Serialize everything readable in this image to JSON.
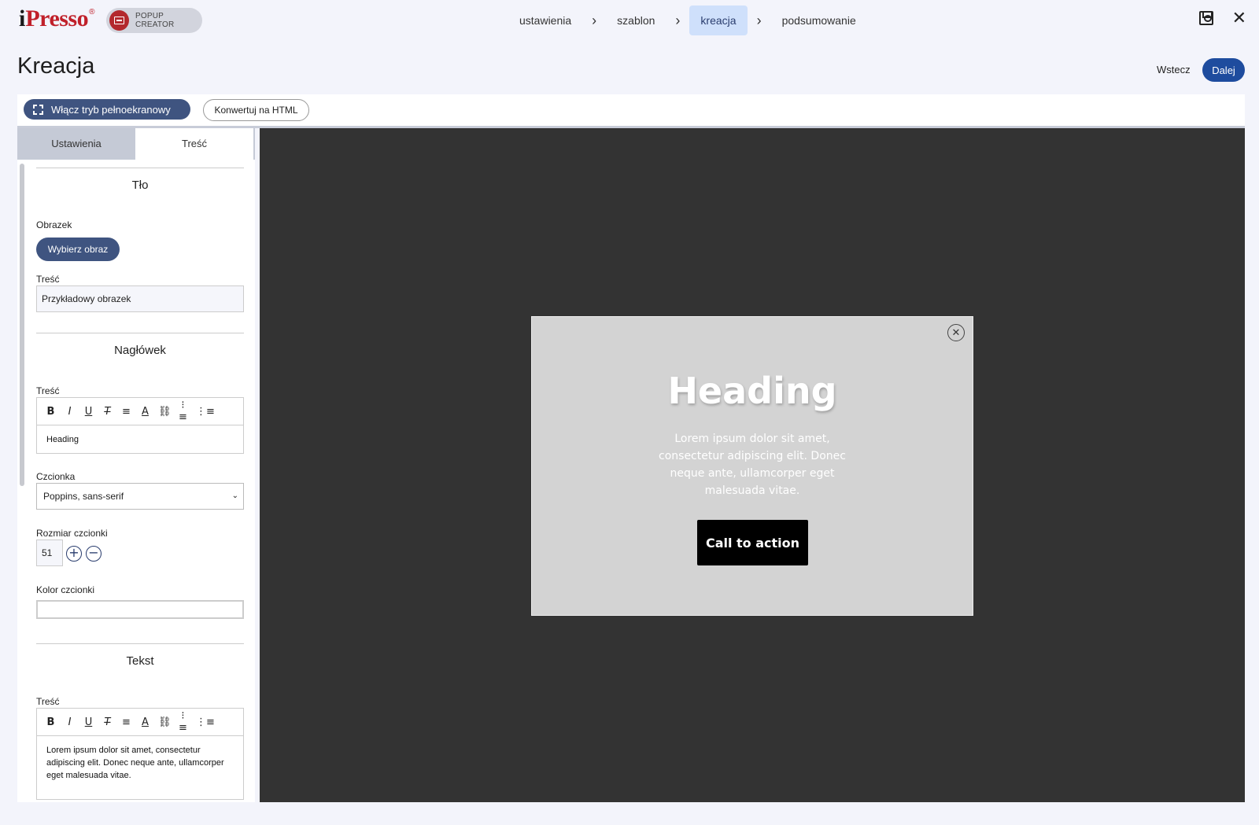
{
  "brand": {
    "logo_i": "i",
    "logo_rest": "Presso",
    "logo_reg": "®",
    "badge": "POPUP CREATOR"
  },
  "steps": [
    {
      "label": "ustawienia"
    },
    {
      "label": "szablon"
    },
    {
      "label": "kreacja",
      "active": true
    },
    {
      "label": "podsumowanie"
    }
  ],
  "page": {
    "title": "Kreacja",
    "back": "Wstecz",
    "next": "Dalej"
  },
  "toolbar": {
    "fullscreen": "Włącz tryb pełnoekranowy",
    "convert": "Konwertuj na HTML"
  },
  "panel": {
    "tabs": [
      "Ustawienia",
      "Treść"
    ],
    "bg": {
      "title": "Tło",
      "image_label": "Obrazek",
      "choose_btn": "Wybierz obraz",
      "content_label": "Treść",
      "content_value": "Przykładowy obrazek"
    },
    "heading": {
      "title": "Nagłówek",
      "content_label": "Treść",
      "content_value": "Heading",
      "font_label": "Czcionka",
      "font_value": "Poppins, sans-serif",
      "size_label": "Rozmiar czcionki",
      "size_value": "51",
      "color_label": "Kolor czcionki"
    },
    "text": {
      "title": "Tekst",
      "content_label": "Treść",
      "content_value": "Lorem ipsum dolor sit amet, consectetur adipiscing elit. Donec neque ante, ullamcorper eget malesuada vitae."
    }
  },
  "popup": {
    "heading": "Heading",
    "text": "Lorem ipsum dolor sit amet, consectetur adipiscing elit. Donec neque ante, ullamcorper eget malesuada vitae.",
    "cta": "Call to action"
  },
  "colors": {
    "accent": "#1e4c9e",
    "pill": "#3f5480",
    "canvas": "#333333",
    "popup": "#d3d3d3"
  }
}
